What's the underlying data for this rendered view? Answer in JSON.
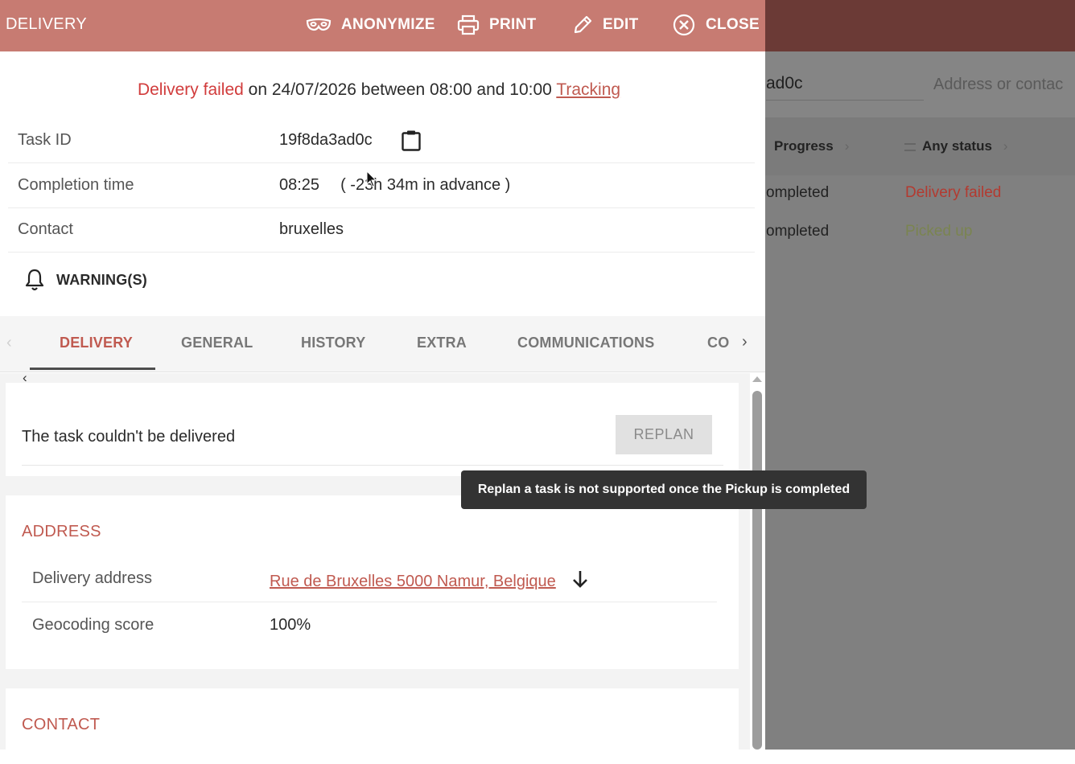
{
  "background": {
    "search_value": "ad0c",
    "search_placeholder": "Address or contac",
    "filters": {
      "progress": "Progress",
      "status": "Any status"
    },
    "rows": [
      {
        "progress": "ompleted",
        "status": "Delivery failed",
        "status_color": "#c0392b"
      },
      {
        "progress": "ompleted",
        "status": "Picked up",
        "status_color": "#7f8a52"
      }
    ]
  },
  "header": {
    "title": "DELIVERY",
    "color": "#c77b72",
    "anonymize": "ANONYMIZE",
    "print": "PRINT",
    "edit": "EDIT",
    "close": "CLOSE"
  },
  "status": {
    "state": "Delivery failed",
    "rest": "on 24/07/2026 between 08:00 and 10:00",
    "tracking": "Tracking"
  },
  "info": {
    "task_id_label": "Task ID",
    "task_id": "19f8da3ad0c",
    "completion_label": "Completion time",
    "completion_time": "08:25",
    "completion_note": "( -23h 34m in advance )",
    "contact_label": "Contact",
    "contact": "bruxelles"
  },
  "warnings": {
    "label": "WARNING(S)"
  },
  "tabs": [
    "DELIVERY",
    "GENERAL",
    "HISTORY",
    "EXTRA",
    "COMMUNICATIONS",
    "CO"
  ],
  "failed_card": {
    "text": "The task couldn't be delivered",
    "replan": "REPLAN"
  },
  "tooltip": "Replan a task is not supported once the Pickup is completed",
  "address": {
    "title": "ADDRESS",
    "delivery_label": "Delivery address",
    "delivery_value": "Rue de Bruxelles 5000 Namur, Belgique",
    "geocoding_label": "Geocoding score",
    "geocoding_value": "100%"
  },
  "contact": {
    "title": "CONTACT"
  },
  "colors": {
    "accent": "#c05a50",
    "failed": "#d13c3c",
    "header": "#c77b72"
  }
}
